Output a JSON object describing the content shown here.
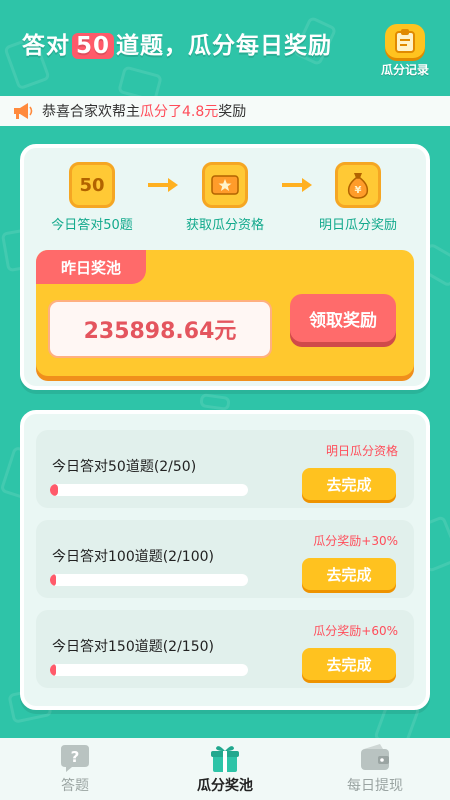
{
  "header": {
    "title_prefix": "答对",
    "title_number": "50",
    "title_suffix": "道题，瓜分每日奖励",
    "record_label": "瓜分记录"
  },
  "notice": {
    "text": "恭喜合家欢帮主",
    "highlight": "瓜分了4.8元",
    "text_end": "奖励"
  },
  "steps": [
    {
      "icon_text": "50",
      "label": "今日答对50题",
      "icon": "badge-50-icon"
    },
    {
      "icon_text": "",
      "label": "获取瓜分资格",
      "icon": "ticket-star-icon"
    },
    {
      "icon_text": "",
      "label": "明日瓜分奖励",
      "icon": "money-bag-icon"
    }
  ],
  "pool": {
    "tag": "昨日奖池",
    "amount": "235898.64元",
    "claim_label": "领取奖励"
  },
  "tasks": [
    {
      "title": "今日答对50道题(2/50)",
      "reward": "明日瓜分资格",
      "progress": 0.04,
      "button": "去完成"
    },
    {
      "title": "今日答对100道题(2/100)",
      "reward": "瓜分奖励+30%",
      "progress": 0.02,
      "button": "去完成"
    },
    {
      "title": "今日答对150道题(2/150)",
      "reward": "瓜分奖励+60%",
      "progress": 0.013,
      "button": "去完成"
    }
  ],
  "nav": [
    {
      "label": "答题",
      "icon": "question-icon",
      "active": false
    },
    {
      "label": "瓜分奖池",
      "icon": "gift-icon",
      "active": true
    },
    {
      "label": "每日提现",
      "icon": "wallet-icon",
      "active": false
    }
  ],
  "colors": {
    "background": "#2ec4a8",
    "accent_red": "#ff5a6a",
    "accent_yellow": "#ffc31f"
  }
}
